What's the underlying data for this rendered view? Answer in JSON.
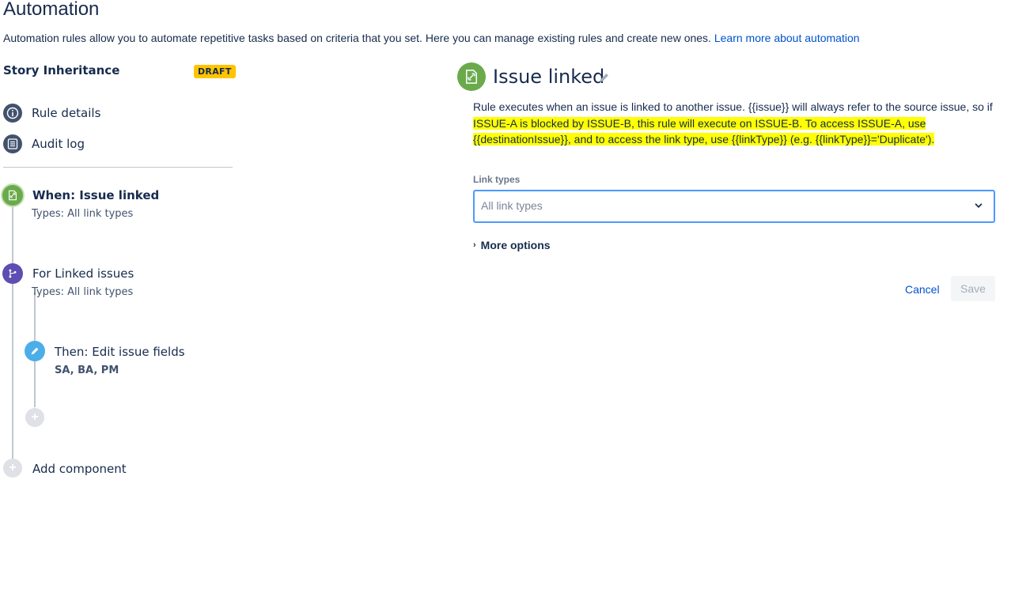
{
  "header": {
    "title": "Automation",
    "description": "Automation rules allow you to automate repetitive tasks based on criteria that you set. Here you can manage existing rules and create new ones.",
    "learn_more_link": "Learn more about automation"
  },
  "rule": {
    "name": "Story Inheritance",
    "status_badge": "DRAFT"
  },
  "nav": {
    "rule_details": "Rule details",
    "audit_log": "Audit log"
  },
  "components": {
    "trigger": {
      "title": "When: Issue linked",
      "subtitle": "Types: All link types"
    },
    "branch": {
      "title": "For Linked issues",
      "subtitle": "Types: All link types"
    },
    "action": {
      "title": "Then: Edit issue fields",
      "subtitle": "SA, BA, PM"
    },
    "add_component": "Add component"
  },
  "panel": {
    "title": "Issue linked",
    "description_plain": "Rule executes when an issue is linked to another issue. {{issue}} will always refer to the source issue, so if",
    "description_highlighted_1": "ISSUE-A is blocked by ISSUE-B, this rule will execute on ISSUE-B. To access ISSUE-A, use",
    "description_highlighted_2": "{{destinationIssue}}, and to access the link type, use {{linkType}} (e.g. {{linkType}}='Duplicate').",
    "link_types_label": "Link types",
    "link_types_value": "All link types",
    "more_options": "More options",
    "cancel_label": "Cancel",
    "save_label": "Save"
  },
  "colors": {
    "trigger_icon": "#6aaa4b",
    "branch_icon": "#5e4db2",
    "action_icon": "#4baee8",
    "highlight": "#ffff00",
    "link": "#0052cc",
    "draft_badge": "#ffc400"
  }
}
